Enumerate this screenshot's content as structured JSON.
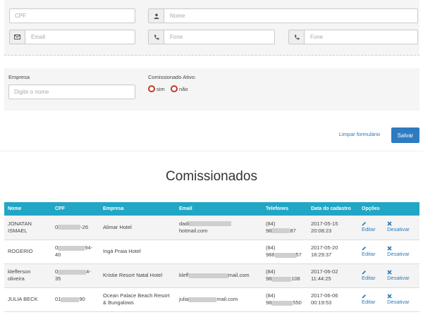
{
  "filters": {
    "cpf_placeholder": "CPF",
    "nome_placeholder": "Nome",
    "email_placeholder": "Email",
    "fone1_placeholder": "Fone",
    "fone2_placeholder": "Fone",
    "empresa_label": "Empresa",
    "empresa_placeholder": "Digite o nome",
    "comissionado_label": "Comissionado Ativo:",
    "radio_sim": "sim",
    "radio_nao": "não",
    "clear_label": "Limpar formulário",
    "save_label": "Salvar"
  },
  "section_title": "Comissionados",
  "table": {
    "headers": [
      "Nome",
      "CPF",
      "Empresa",
      "Email",
      "Telefones",
      "Data do cadastro",
      "Opções"
    ],
    "rows": [
      {
        "nome": "JONATAN ISMAEL",
        "cpf_pre": "0",
        "cpf_suf": "-26",
        "empresa": "Alimar Hotel",
        "email_pre": "dadi",
        "email_suf": "hotmail.com",
        "tel_ddd": "(84)",
        "tel_pre": "98",
        "tel_suf": "87",
        "data": "2017-05-15",
        "hora": "20:08:23",
        "edit": "Editar",
        "disable": "Desativar"
      },
      {
        "nome": "ROGERIO",
        "cpf_pre": "0",
        "cpf_suf": "94-40",
        "empresa": "Ingá Praia Hotel",
        "email_pre": "",
        "email_suf": "",
        "tel_ddd": "(84)",
        "tel_pre": "988",
        "tel_suf": "57",
        "data": "2017-05-20",
        "hora": "18:29:37",
        "edit": "Editar",
        "disable": "Desativar"
      },
      {
        "nome": "klefferson oliveira",
        "cpf_pre": "0",
        "cpf_suf": "4-35",
        "empresa": "Kristie Resort Natal Hotel",
        "email_pre": "kleff",
        "email_suf": "mail.com",
        "tel_ddd": "(84)",
        "tel_pre": "98",
        "tel_suf": "106",
        "data": "2017-06-02",
        "hora": "11:44:25",
        "edit": "Editar",
        "disable": "Desativar"
      },
      {
        "nome": "JULIA BECK",
        "cpf_pre": "01",
        "cpf_suf": "90",
        "empresa": "Ocean Palace Beach Resort & Bungalows",
        "email_pre": "julia",
        "email_suf": "mail.com",
        "tel_ddd": "(84)",
        "tel_pre": "98",
        "tel_suf": "550",
        "data": "2017-06-06",
        "hora": "00:19:53",
        "edit": "Editar",
        "disable": "Desativar"
      }
    ]
  },
  "icons": [
    "user-icon",
    "envelope-icon",
    "phone-icon",
    "pencil-icon",
    "times-icon"
  ],
  "colors": {
    "header_bg": "#21a6c5",
    "primary_button": "#2f7bbf",
    "link": "#2a7ab8",
    "radio_border": "#c0392b"
  }
}
